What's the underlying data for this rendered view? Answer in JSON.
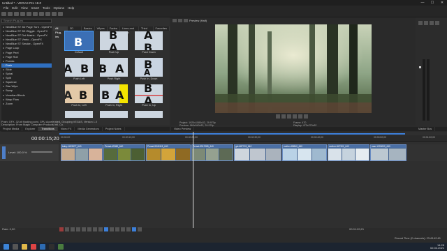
{
  "window": {
    "title": "Untitled * - VEGAS Pro 18.0",
    "buttons": [
      "—",
      "☐",
      "✕"
    ]
  },
  "menu": [
    "File",
    "Edit",
    "View",
    "Insert",
    "Tools",
    "Options",
    "Help"
  ],
  "fx": {
    "search_placeholder": "Search Plug-ins",
    "tabs": [
      "All Plug-ins",
      "3D Effects",
      "Basics",
      "Wipes",
      "Fades",
      "Lines and Rects",
      "Third Party",
      "Favorites"
    ],
    "list": [
      "NewBlue ST 3D Page Turn - OpenFX",
      "NewBlue ST 3D Wiggle - OpenFX",
      "NewBlue ST Dot Matrix - OpenFX",
      "NewBlue ST Vento - OpenFX",
      "NewBlue ST Smoke - OpenFX",
      "Page Loop",
      "Page Peel",
      "Page Roll",
      "Portals",
      "Push",
      "Slide",
      "Spiral",
      "Split",
      "Squeeze",
      "Star Wipe",
      "Swap",
      "Venetian Blinds",
      "Warp Flow",
      "Zoom"
    ],
    "selected": "Push",
    "thumbs": [
      "Default",
      "Push Up",
      "Push Down",
      "Push Left",
      "Push Right",
      "Push In, Down",
      "Push In, Left",
      "Push In, Right",
      "Push In, Up"
    ],
    "description": "Push: OFX, 32-bit floating point, GPU Accelerated, Grouping VEGAS, Version 1.0\nDescription: From Magix Computer Products Intl. Co."
  },
  "bottom_tabs_left": [
    "Project Media",
    "Explorer",
    "Transitions",
    "Video FX",
    "Media Generators",
    "Project Notes"
  ],
  "preview": {
    "mode": "Preview (Half)",
    "info_left": [
      "Project: 1920x1080x32, 29.970p",
      "Preview: 960x540x32, 29.970p",
      "Display: 472x270x32"
    ],
    "info_right": [
      "Frame: 470",
      "Display: 472x270x32"
    ],
    "tab": "Video Preview"
  },
  "master_bus": {
    "label": "Master Bus",
    "tab": "Master Bus"
  },
  "timeline": {
    "timecode": "00:00:15;20",
    "track_level": "Level: 100.0 %",
    "rate": "Rate: 0,00",
    "ruler_marks": [
      "00:00:00",
      "00:00:10;00",
      "00:00:20;00",
      "00:00:30;00",
      "00:00:40;00",
      "00:00:50;00",
      "00:01:00;00"
    ],
    "clips": [
      "baby-1423577_640",
      "Persat-49360_640",
      "Persat-9940115_640",
      "Persat-9917085_640",
      "get-687715_640",
      "mother-89840_640",
      "mother-847301_640",
      "man-1226000_640"
    ],
    "end_time": "00:01:09;21"
  },
  "status": {
    "record_time": "Record Time (2 channels): 23:43:42:45"
  },
  "taskbar": {
    "time": "14:28",
    "date": "02.04.2021",
    "lang": "РУС"
  }
}
